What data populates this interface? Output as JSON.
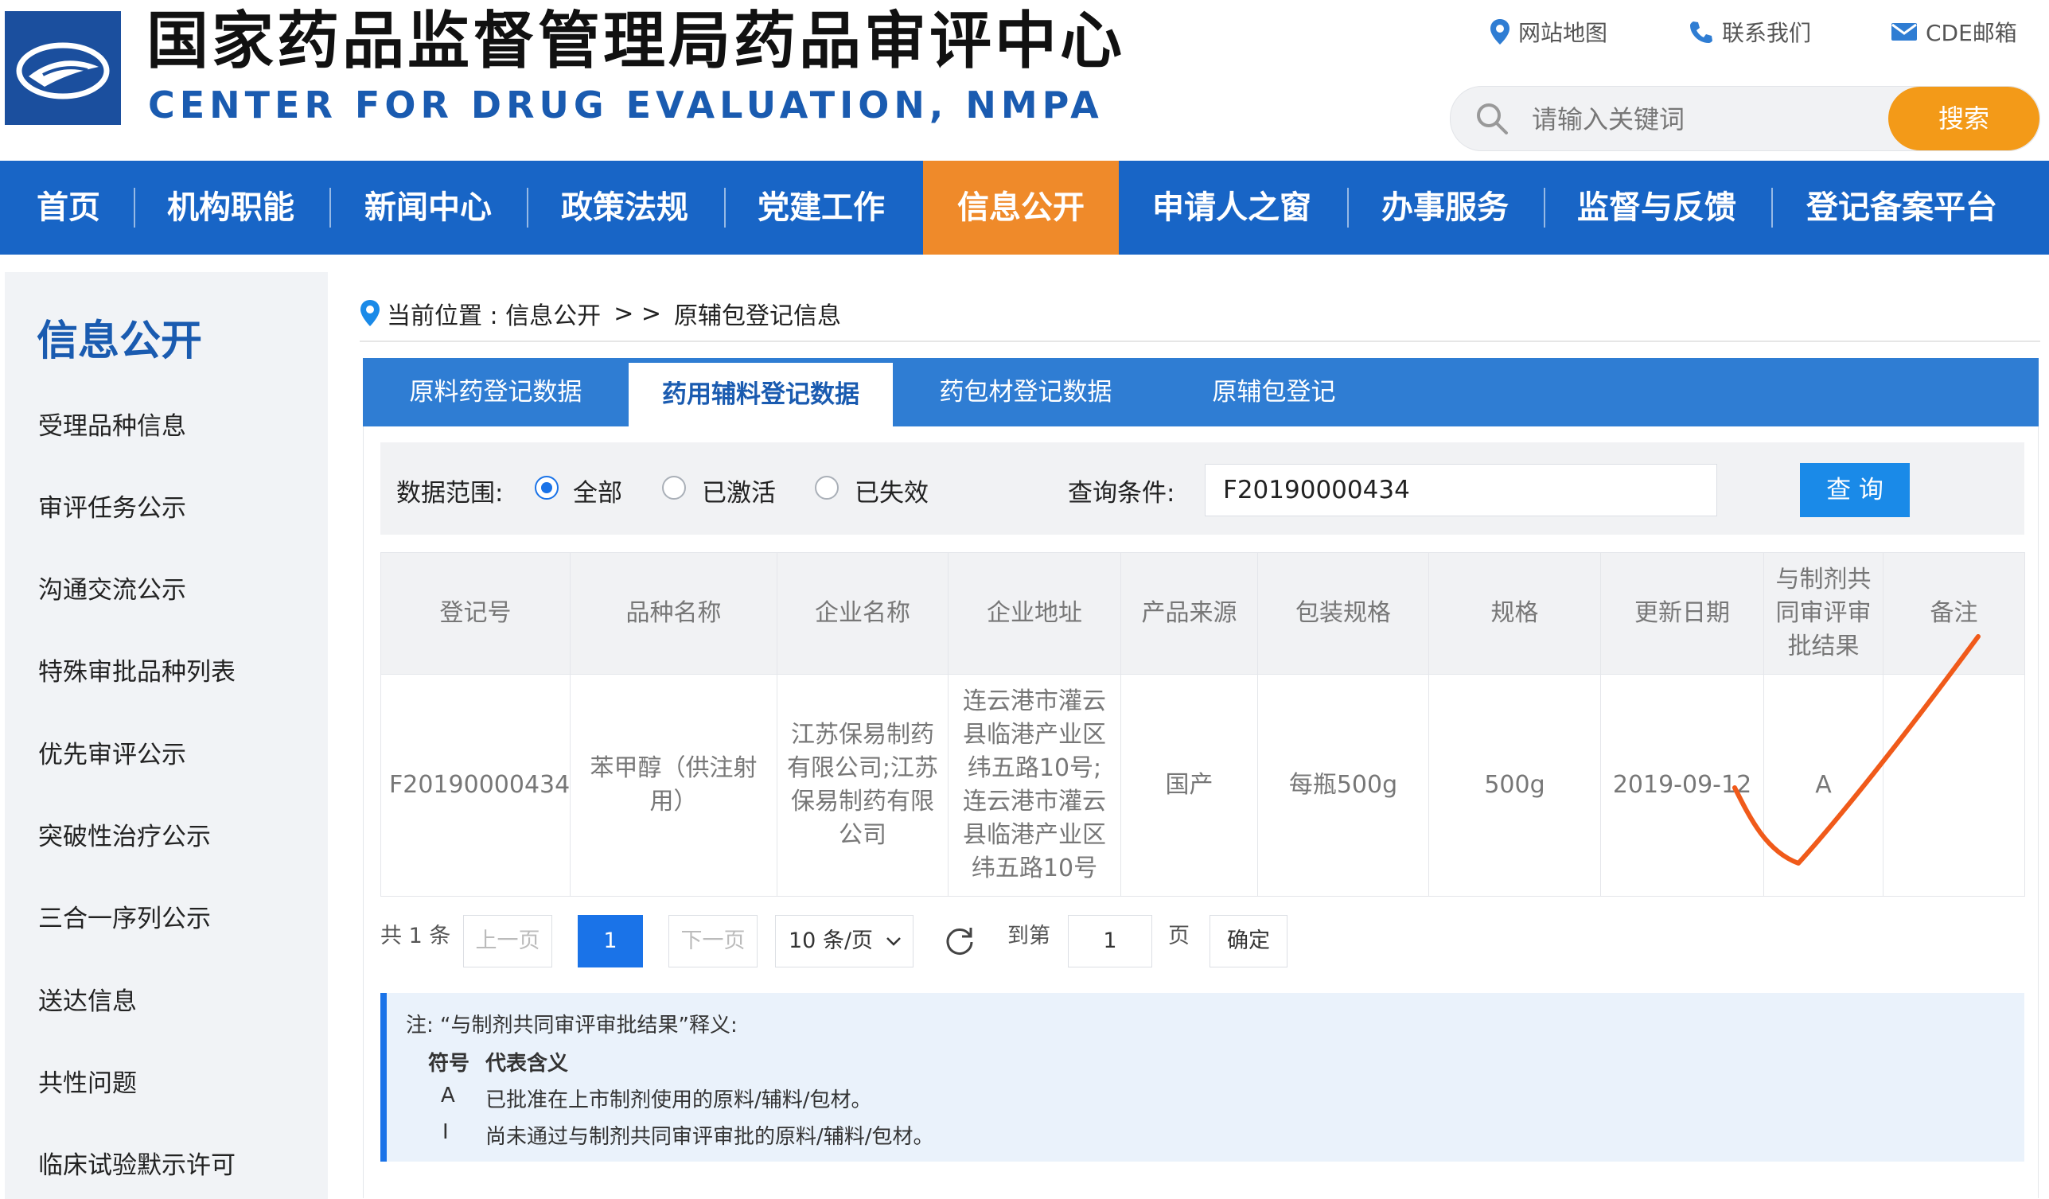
{
  "header": {
    "title_cn": "国家药品监督管理局药品审评中心",
    "title_en": "CENTER FOR DRUG EVALUATION, NMPA",
    "links": [
      "网站地图",
      "联系我们",
      "CDE邮箱"
    ],
    "search": {
      "placeholder": "请输入关键词",
      "button": "搜索"
    }
  },
  "nav": [
    "首页",
    "机构职能",
    "新闻中心",
    "政策法规",
    "党建工作",
    "信息公开",
    "申请人之窗",
    "办事服务",
    "监督与反馈",
    "登记备案平台"
  ],
  "nav_active": "信息公开",
  "sidebar": {
    "title": "信息公开",
    "items": [
      "受理品种信息",
      "审评任务公示",
      "沟通交流公示",
      "特殊审批品种列表",
      "优先审评公示",
      "突破性治疗公示",
      "三合一序列公示",
      "送达信息",
      "共性问题",
      "临床试验默示许可"
    ]
  },
  "breadcrumb": {
    "prefix": "当前位置 : 信息公开",
    "sep": "> >",
    "current": "原辅包登记信息"
  },
  "tabs": [
    "原料药登记数据",
    "药用辅料登记数据",
    "药包材登记数据",
    "原辅包登记"
  ],
  "tab_active": "药用辅料登记数据",
  "filter": {
    "scope_label": "数据范围:",
    "options": [
      "全部",
      "已激活",
      "已失效"
    ],
    "selected": "全部",
    "query_label": "查询条件:",
    "query_value": "F20190000434",
    "query_button": "查 询"
  },
  "table": {
    "headers": [
      "登记号",
      "品种名称",
      "企业名称",
      "企业地址",
      "产品来源",
      "包装规格",
      "规格",
      "更新日期",
      "与制剂共同审评审批结果",
      "备注"
    ],
    "rows": [
      [
        "F20190000434",
        "苯甲醇（供注射用）",
        "江苏保易制药有限公司;江苏保易制药有限公司",
        "连云港市灌云县临港产业区纬五路10号;连云港市灌云县临港产业区纬五路10号",
        "国产",
        "每瓶500g",
        "500g",
        "2019-09-12",
        "A",
        ""
      ]
    ]
  },
  "pagination": {
    "total": "共 1 条",
    "prev": "上一页",
    "current": "1",
    "next": "下一页",
    "page_size": "10 条/页",
    "goto_label": "到第",
    "goto_value": "1",
    "page_unit": "页",
    "confirm": "确定"
  },
  "note": {
    "title": "注: “与制剂共同审评审批结果”释义:",
    "col_symbol": "符号",
    "col_meaning": "代表含义",
    "entries": [
      {
        "symbol": "A",
        "meaning": "已批准在上市制剂使用的原料/辅料/包材。"
      },
      {
        "symbol": "I",
        "meaning": "尚未通过与制剂共同审评审批的原料/辅料/包材。"
      }
    ]
  },
  "colors": {
    "brand_blue": "#1865c6",
    "accent_orange": "#ef8a2a",
    "checkmark": "#f05a1a"
  }
}
